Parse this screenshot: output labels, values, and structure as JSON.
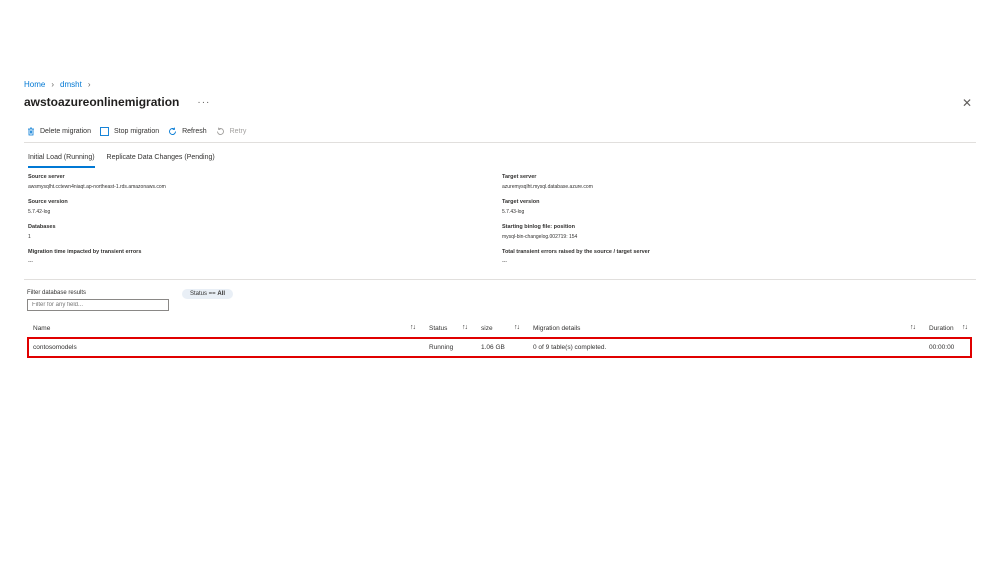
{
  "breadcrumb": {
    "items": [
      "Home",
      "dmsht"
    ]
  },
  "header": {
    "title": "awstoazureonlinemigration",
    "more": "···",
    "close": "✕"
  },
  "toolbar": {
    "delete_label": "Delete migration",
    "stop_label": "Stop migration",
    "refresh_label": "Refresh",
    "retry_label": "Retry"
  },
  "tabs": [
    {
      "label": "Initial Load (Running)",
      "active": true
    },
    {
      "label": "Replicate Data Changes (Pending)",
      "active": false
    }
  ],
  "properties": {
    "source_server": {
      "label": "Source server",
      "value": "awsmysqlht.cctewn4niaqt.ap-northeast-1.rds.amazonaws.com"
    },
    "source_version": {
      "label": "Source version",
      "value": "5.7.42-log"
    },
    "databases": {
      "label": "Databases",
      "value": "1"
    },
    "migration_time": {
      "label": "Migration time impacted by transient errors",
      "value": "---"
    },
    "target_server": {
      "label": "Target server",
      "value": "azuremysqlht.mysql.database.azure.com"
    },
    "target_version": {
      "label": "Target version",
      "value": "5.7.43-log"
    },
    "binlog": {
      "label": "Starting binlog file: position",
      "value": "mysql-bin-changelog.002719: 154"
    },
    "transient_errors": {
      "label": "Total transient errors raised by the source / target server",
      "value": "---"
    }
  },
  "filter": {
    "label": "Filter database results",
    "placeholder": "Filter for any field...",
    "status_prefix": "Status ==",
    "status_value": "All"
  },
  "table": {
    "headers": {
      "name": "Name",
      "status": "Status",
      "size": "size",
      "details": "Migration details",
      "duration": "Duration"
    },
    "sort_icon": "↑↓",
    "rows": [
      {
        "name": "contosomodels",
        "status": "Running",
        "size": "1.06 GB",
        "details": "0 of 9 table(s) completed.",
        "duration": "00:00:00"
      }
    ]
  },
  "colors": {
    "accent": "#0078d4",
    "highlight": "#e00000"
  }
}
